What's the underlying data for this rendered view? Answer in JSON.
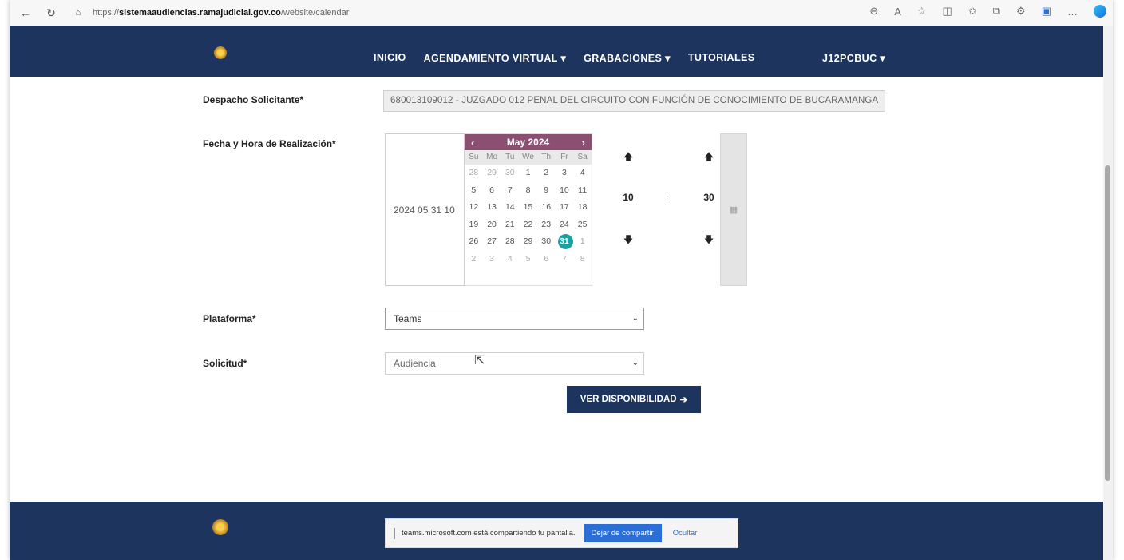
{
  "browser": {
    "back_icon": "back-arrow-icon",
    "refresh_icon": "refresh-icon",
    "url_prefix": "https://",
    "url_host": "sistemaaudiencias.ramajudicial.gov.co",
    "url_path": "/website/calendar"
  },
  "nav": {
    "items": [
      "INICIO",
      "AGENDAMIENTO VIRTUAL ▾",
      "GRABACIONES ▾",
      "TUTORIALES"
    ],
    "user": "J12PCBUC ▾"
  },
  "form": {
    "despacho_label": "Despacho Solicitante*",
    "despacho_value": "680013109012 - JUZGADO 012 PENAL DEL CIRCUITO CON FUNCIÓN DE CONOCIMIENTO DE BUCARAMANGA",
    "fecha_label": "Fecha y Hora de Realización*",
    "fecha_value": "2024 05 31 10",
    "plataforma_label": "Plataforma*",
    "plataforma_value": "Teams",
    "solicitud_label": "Solicitud*",
    "solicitud_value": "Audiencia",
    "submit_label": "VER DISPONIBILIDAD"
  },
  "calendar": {
    "month": "May 2024",
    "prev": "‹",
    "next": "›",
    "dow": [
      "Su",
      "Mo",
      "Tu",
      "We",
      "Th",
      "Fr",
      "Sa"
    ],
    "weeks": [
      [
        "28",
        "29",
        "30",
        "1",
        "2",
        "3",
        "4"
      ],
      [
        "5",
        "6",
        "7",
        "8",
        "9",
        "10",
        "11"
      ],
      [
        "12",
        "13",
        "14",
        "15",
        "16",
        "17",
        "18"
      ],
      [
        "19",
        "20",
        "21",
        "22",
        "23",
        "24",
        "25"
      ],
      [
        "26",
        "27",
        "28",
        "29",
        "30",
        "31",
        "1"
      ],
      [
        "2",
        "3",
        "4",
        "5",
        "6",
        "7",
        "8"
      ]
    ],
    "selected": "31"
  },
  "time": {
    "hour": "10",
    "minute": "30",
    "separator": ":",
    "up": "🡅",
    "down": "🡇"
  },
  "share": {
    "message": "teams.microsoft.com está compartiendo tu pantalla.",
    "stop": "Dejar de compartir",
    "hide": "Ocultar"
  },
  "colors": {
    "navy": "#1d355e",
    "calendar_header": "#8b4f72",
    "selected_day": "#17a3a3"
  }
}
